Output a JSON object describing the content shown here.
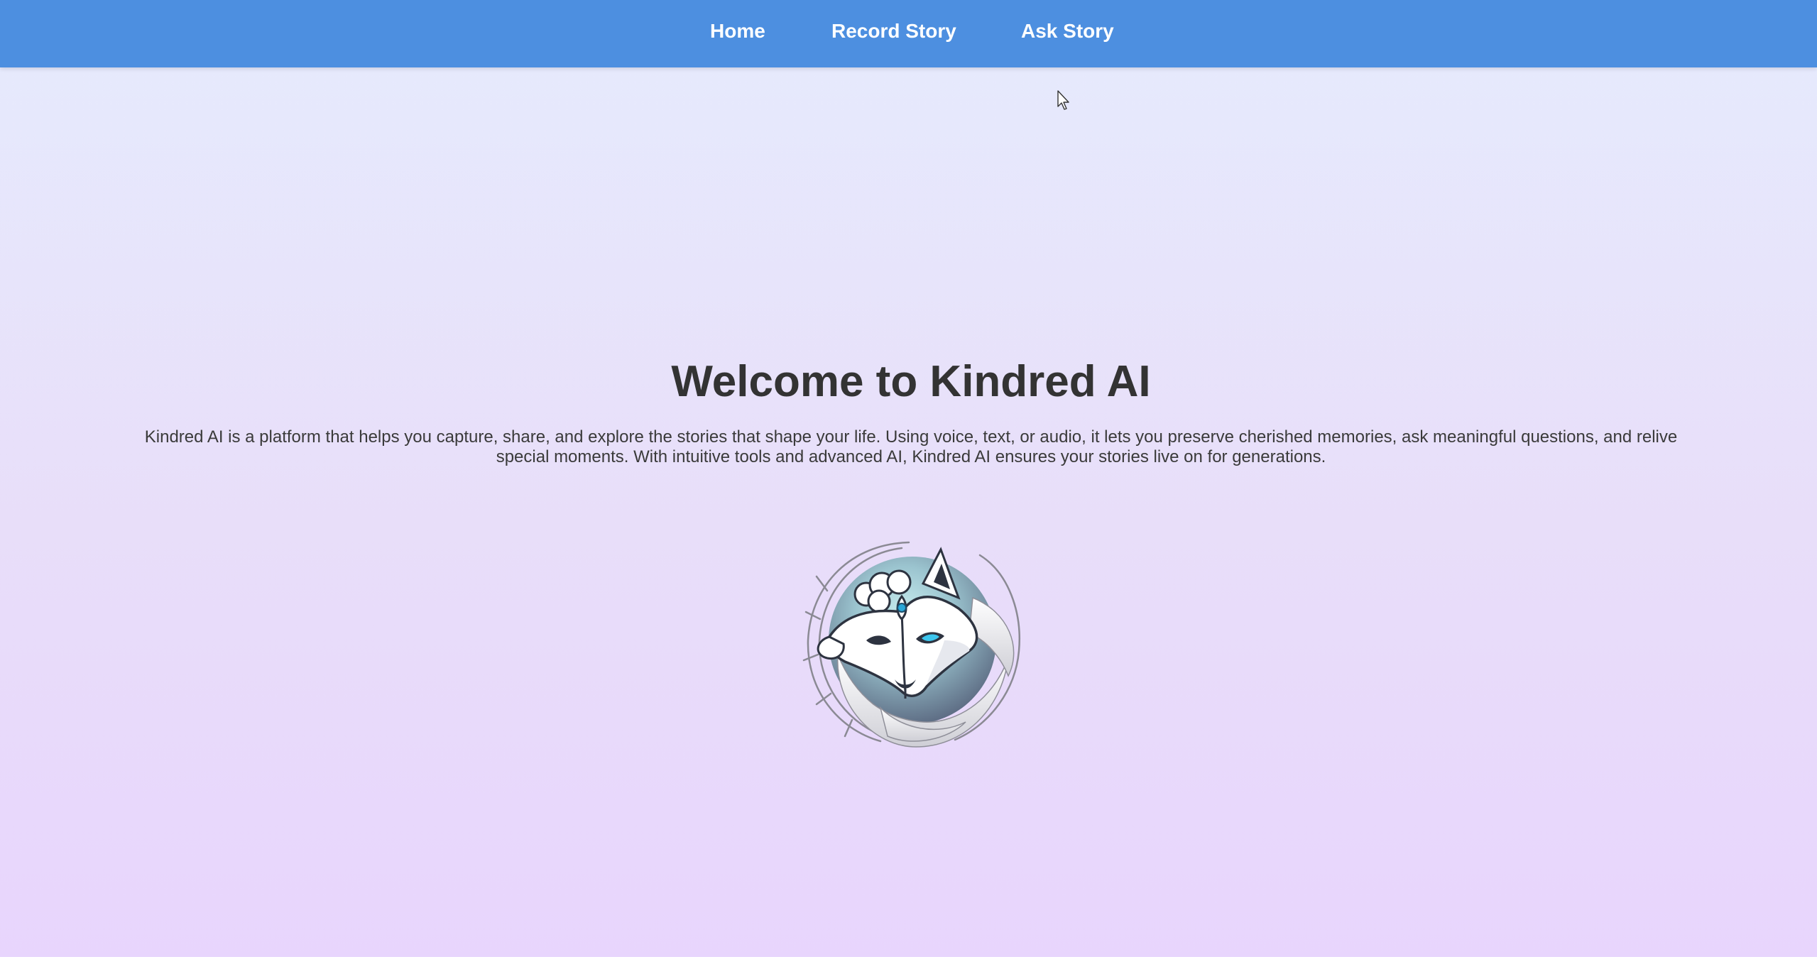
{
  "nav": {
    "home_label": "Home",
    "record_label": "Record Story",
    "ask_label": "Ask Story"
  },
  "hero": {
    "title": "Welcome to Kindred AI",
    "description": "Kindred AI is a platform that helps you capture, share, and explore the stories that shape your life. Using voice, text, or audio, it lets you preserve cherished memories, ask meaningful questions, and relive special moments. With intuitive tools and advanced AI, Kindred AI ensures your stories live on for generations."
  },
  "logo": {
    "icon": "wolf-lamb-logo-icon"
  },
  "colors": {
    "nav_bg": "#4d8fe0",
    "title": "#333333",
    "accent": "#2aa7d8"
  }
}
